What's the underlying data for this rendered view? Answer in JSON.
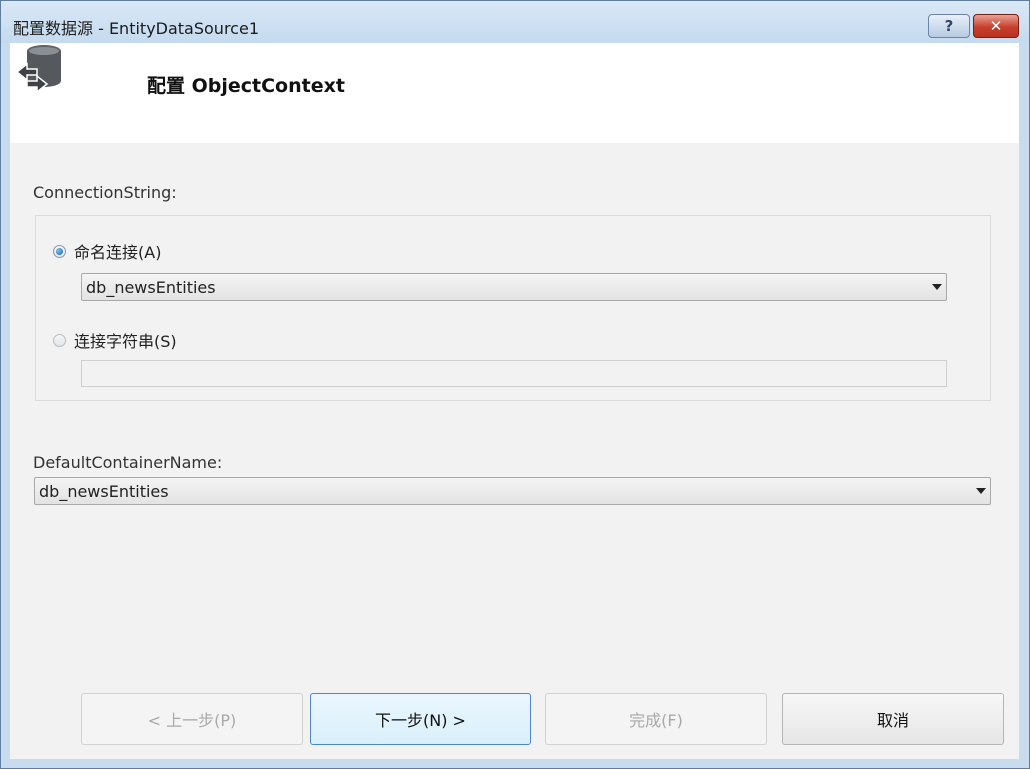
{
  "window": {
    "title": "配置数据源 - EntityDataSource1",
    "help_label": "?",
    "close_label": "✕"
  },
  "header": {
    "title": "配置 ObjectContext",
    "icon": "database-refresh-icon"
  },
  "connection": {
    "label": "ConnectionString:",
    "named_option_label": "命名连接(A)",
    "named_selected": true,
    "named_value": "db_newsEntities",
    "string_option_label": "连接字符串(S)",
    "string_value": ""
  },
  "container": {
    "label": "DefaultContainerName:",
    "value": "db_newsEntities"
  },
  "buttons": {
    "prev": "< 上一步(P)",
    "next": "下一步(N) >",
    "finish": "完成(F)",
    "cancel": "取消"
  },
  "colors": {
    "title_bar": "#c5daef",
    "close_button": "#c7402c",
    "focus_border": "#4b8ac9"
  }
}
